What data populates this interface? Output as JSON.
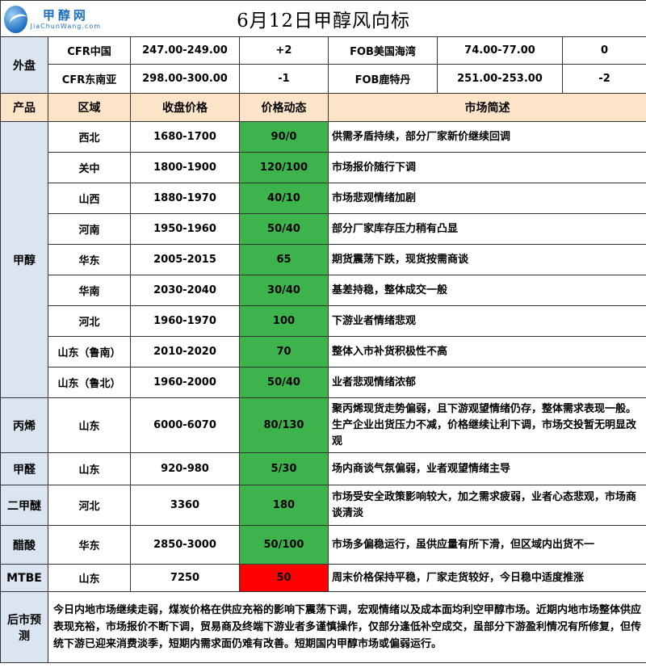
{
  "logo": {
    "name_cn": "甲醇网",
    "name_en": "JiaChunWang.com"
  },
  "title": "6月12日甲醇风向标",
  "outer": {
    "label": "外盘",
    "rows": [
      {
        "name1": "CFR中国",
        "price1": "247.00-249.00",
        "change1": "+2",
        "name2": "FOB美国海湾",
        "price2": "74.00-77.00",
        "change2": "0"
      },
      {
        "name1": "CFR东南亚",
        "price1": "298.00-300.00",
        "change1": "-1",
        "name2": "FOB鹿特丹",
        "price2": "251.00-253.00",
        "change2": "-2"
      }
    ]
  },
  "headers": {
    "product": "产品",
    "region": "区域",
    "price": "收盘价格",
    "change": "价格动态",
    "desc": "市场简述"
  },
  "methanol": {
    "product": "甲醇",
    "rows": [
      {
        "region": "西北",
        "price": "1680-1700",
        "change": "90/0",
        "desc": "供需矛盾持续，部分厂家新价继续回调"
      },
      {
        "region": "关中",
        "price": "1800-1900",
        "change": "120/100",
        "desc": "市场报价随行下调"
      },
      {
        "region": "山西",
        "price": "1880-1970",
        "change": "40/10",
        "desc": "市场悲观情绪加剧"
      },
      {
        "region": "河南",
        "price": "1950-1960",
        "change": "50/40",
        "desc": "部分厂家库存压力稍有凸显"
      },
      {
        "region": "华东",
        "price": "2005-2015",
        "change": "65",
        "desc": "期货震荡下跌，现货按需商谈"
      },
      {
        "region": "华南",
        "price": "2030-2040",
        "change": "30/40",
        "desc": "基差持稳，整体成交一般"
      },
      {
        "region": "河北",
        "price": "1960-1970",
        "change": "100",
        "desc": "下游业者情绪悲观"
      },
      {
        "region": "山东（鲁南）",
        "price": "2010-2020",
        "change": "70",
        "desc": "整体入市补货积极性不高"
      },
      {
        "region": "山东（鲁北）",
        "price": "1960-2000",
        "change": "50/40",
        "desc": "业者悲观情绪浓郁"
      }
    ]
  },
  "others": [
    {
      "product": "丙烯",
      "region": "山东",
      "price": "6000-6070",
      "change": "80/130",
      "desc": "聚丙烯现货走势偏弱，且下游观望情绪仍存，整体需求表现一般。生产企业出货压力不减，价格继续让利下调，市场交投暂无明显改观"
    },
    {
      "product": "甲醛",
      "region": "山东",
      "price": "920-980",
      "change": "5/30",
      "desc": "场内商谈气氛偏弱，业者观望情绪主导"
    },
    {
      "product": "二甲醚",
      "region": "河北",
      "price": "3360",
      "change": "180",
      "desc": "市场受安全政策影响较大，加之需求疲弱，业者心态悲观，市场商谈清淡"
    },
    {
      "product": "醋酸",
      "region": "华东",
      "price": "2850-3000",
      "change": "50/100",
      "desc": "市场多偏稳运行，虽供应量有所下滑，但区域内出货不一"
    },
    {
      "product": "MTBE",
      "region": "山东",
      "price": "7250",
      "change": "50",
      "desc": "周末价格保持平稳，厂家走货较好，今日稳中适度推涨"
    }
  ],
  "forecast": {
    "label": "后市预测",
    "text": "今日内地市场继续走弱，煤炭价格在供应充裕的影响下震荡下调，宏观情绪以及成本面均利空甲醇市场。近期内地市场整体供应表现充裕，市场报价不断下调，贸易商及终端下游业者多谨慎操作，仅部分逢低补空成交，虽部分下游盈利情况有所修复，但传统下游已迎来消费淡季，短期内需求面仍难有改善。短期国内甲醇市场或偏弱运行。"
  },
  "colors": {
    "green": "#3cb44b",
    "red": "#ff0000",
    "category_bg": "#dbe5f1",
    "header_bg": "#fce4c8"
  }
}
